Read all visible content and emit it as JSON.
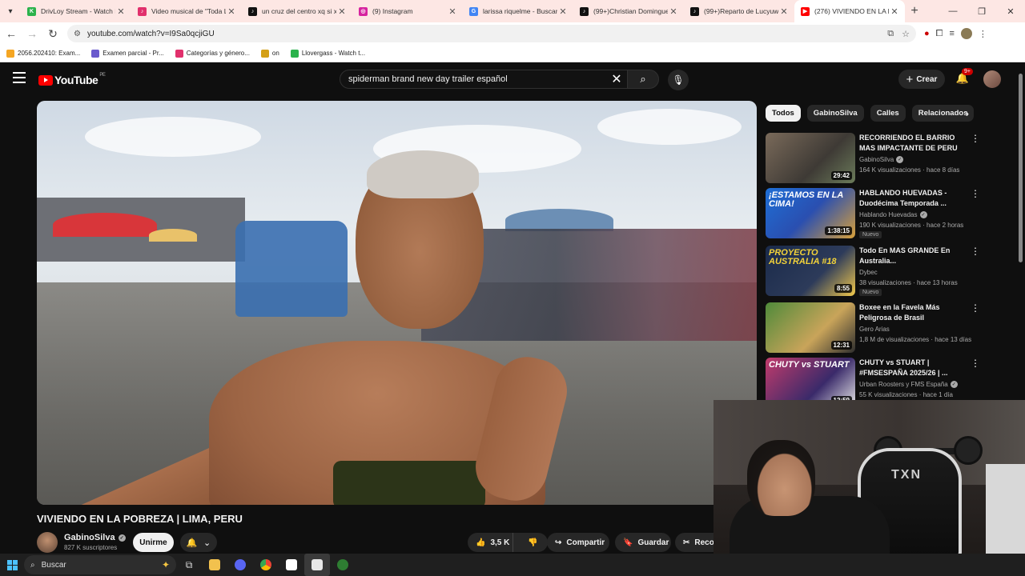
{
  "browser": {
    "tabs": [
      {
        "title": "DrivLoy Stream - Watch L",
        "color": "#2bb24c",
        "glyph": "K"
      },
      {
        "title": "Video musical de \"Toda L",
        "color": "#e1306c",
        "glyph": "♪"
      },
      {
        "title": "un cruz del centro xq si x",
        "color": "#111111",
        "glyph": "♪"
      },
      {
        "title": "(9) Instagram",
        "color": "#d6249f",
        "glyph": "◎"
      },
      {
        "title": "larissa riquelme - Buscar c",
        "color": "#4285f4",
        "glyph": "G"
      },
      {
        "title": "(99+)Christian Dominguez",
        "color": "#111111",
        "glyph": "♪"
      },
      {
        "title": "(99+)Reparto de Lucyuwi",
        "color": "#111111",
        "glyph": "♪"
      },
      {
        "title": "(276) VIVIENDO EN LA PO",
        "color": "#ff0000",
        "glyph": "▶",
        "active": true
      }
    ],
    "new_tab": "+",
    "url": "youtube.com/watch?v=I9Sa0qcjiGU",
    "bookmarks": [
      {
        "label": "2056.202410: Exam...",
        "color": "#f5a623"
      },
      {
        "label": "Examen parcial - Pr...",
        "color": "#6a5acd"
      },
      {
        "label": "Categorías y género...",
        "color": "#e1306c"
      },
      {
        "label": "on",
        "color": "#d4a017"
      },
      {
        "label": "Llovergass - Watch t...",
        "color": "#2bb24c"
      }
    ]
  },
  "youtube": {
    "logo_text": "YouTube",
    "region": "PE",
    "search_value": "spiderman brand new day trailer español",
    "create_label": "Crear",
    "notif_badge": "9+",
    "video": {
      "title": "VIVIENDO EN LA POBREZA | LIMA, PERU",
      "channel": "GabinoSilva",
      "subscribers": "827 K suscriptores",
      "join_label": "Unirme",
      "likes": "3,5 K",
      "share_label": "Compartir",
      "save_label": "Guardar",
      "clip_label": "Reco"
    },
    "chips": [
      "Todos",
      "GabinoSilva",
      "Calles",
      "Relacionados"
    ],
    "recommendations": [
      {
        "title": "RECORRIENDO EL BARRIO MAS IMPACTANTE DE PERU",
        "channel": "GabinoSilva",
        "verified": true,
        "meta": "164 K visualizaciones · hace 8 días",
        "duration": "29:42",
        "badge": "",
        "thumb_text": ""
      },
      {
        "title": "HABLANDO HUEVADAS - Duodécima Temporada ...",
        "channel": "Hablando Huevadas",
        "verified": true,
        "meta": "190 K visualizaciones · hace 2 horas",
        "duration": "1:38:15",
        "badge": "Nuevo",
        "thumb_text": "¡ESTAMOS EN LA CIMA!"
      },
      {
        "title": "Todo En MAS GRANDE En Australia...",
        "channel": "Dybec",
        "verified": false,
        "meta": "38 visualizaciones · hace 13 horas",
        "duration": "8:55",
        "badge": "Nuevo",
        "thumb_text": "PROYECTO AUSTRALIA #18"
      },
      {
        "title": "Boxee en la Favela Más Peligrosa de Brasil",
        "channel": "Gero Arias",
        "verified": false,
        "meta": "1,8 M de visualizaciones · hace 13 días",
        "duration": "12:31",
        "badge": "",
        "thumb_text": ""
      },
      {
        "title": "CHUTY vs STUART | #FMSESPAÑA 2025/26 | ...",
        "channel": "Urban Roosters y FMS España",
        "verified": true,
        "meta": "55 K visualizaciones · hace 1 día",
        "duration": "12:59",
        "badge": "",
        "thumb_text": "CHUTY vs STUART"
      }
    ]
  },
  "webcam": {
    "chair_logo": "TXN"
  },
  "taskbar": {
    "search_placeholder": "Buscar",
    "apps": [
      "task-view",
      "file-explorer",
      "discord",
      "chrome",
      "capcut",
      "notepad",
      "app"
    ]
  }
}
